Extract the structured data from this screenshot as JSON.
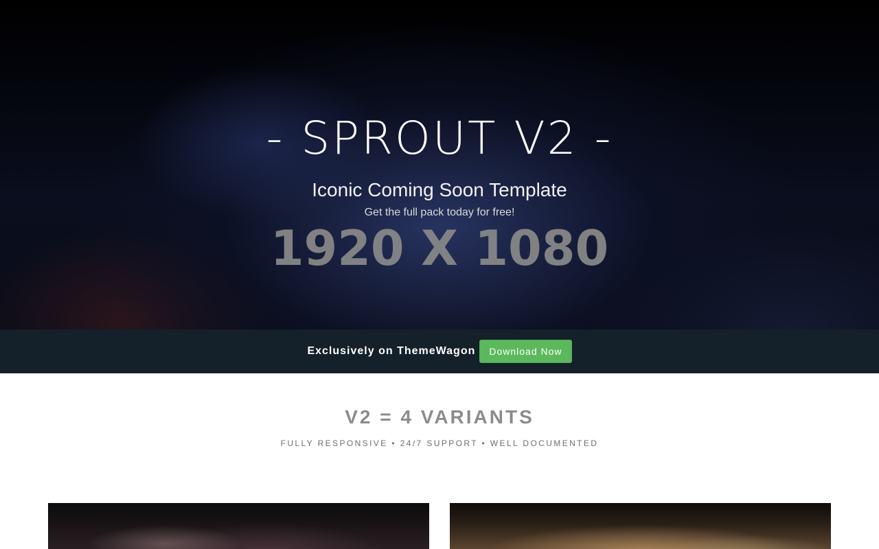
{
  "hero": {
    "title": "- SPROUT V2 -",
    "subtitle": "Iconic Coming Soon Template",
    "tagline": "Get the full pack today for free!",
    "placeholder_text": "1920 X 1080"
  },
  "banner": {
    "text": "Exclusively on ThemeWagon",
    "button_label": "Download Now",
    "button_color": "#5cb85c",
    "background_color": "#14202a"
  },
  "features": {
    "heading": "V2 = 4 VARIANTS",
    "subheading": "FULLY RESPONSIVE • 24/7 SUPPORT • WELL DOCUMENTED"
  }
}
